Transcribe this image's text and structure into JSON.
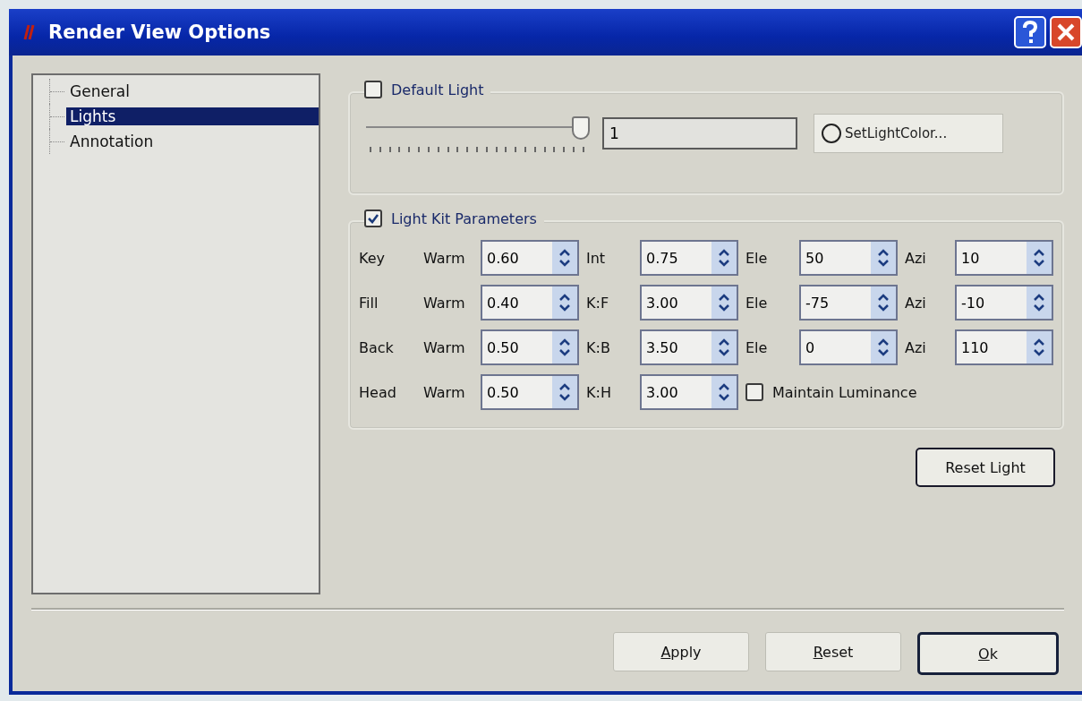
{
  "window": {
    "title": "Render View Options"
  },
  "tree": [
    {
      "label": "General",
      "selected": false
    },
    {
      "label": "Lights",
      "selected": true
    },
    {
      "label": "Annotation",
      "selected": false
    }
  ],
  "default_light": {
    "label": "Default Light",
    "checked": false,
    "slider": {
      "level": 1
    },
    "value": "1",
    "color_button": "SetLightColor..."
  },
  "light_kit": {
    "label": "Light Kit Parameters",
    "checked": true,
    "rows": [
      {
        "name": "Key",
        "fields": [
          {
            "label": "Warm",
            "value": "0.60"
          },
          {
            "label": "Int",
            "value": "0.75"
          },
          {
            "label": "Ele",
            "value": "50"
          },
          {
            "label": "Azi",
            "value": "10"
          }
        ]
      },
      {
        "name": "Fill",
        "fields": [
          {
            "label": "Warm",
            "value": "0.40"
          },
          {
            "label": "K:F",
            "value": "3.00"
          },
          {
            "label": "Ele",
            "value": "-75"
          },
          {
            "label": "Azi",
            "value": "-10"
          }
        ]
      },
      {
        "name": "Back",
        "fields": [
          {
            "label": "Warm",
            "value": "0.50"
          },
          {
            "label": "K:B",
            "value": "3.50"
          },
          {
            "label": "Ele",
            "value": "0"
          },
          {
            "label": "Azi",
            "value": "110"
          }
        ]
      },
      {
        "name": "Head",
        "fields": [
          {
            "label": "Warm",
            "value": "0.50"
          },
          {
            "label": "K:H",
            "value": "3.00"
          }
        ]
      }
    ],
    "maintain_luminance": {
      "label": "Maintain Luminance",
      "checked": false
    }
  },
  "reset_light_button": "Reset Light",
  "buttons": [
    {
      "label": "Apply",
      "default": false
    },
    {
      "label": "Reset",
      "default": false
    },
    {
      "label": "Ok",
      "default": true
    }
  ]
}
